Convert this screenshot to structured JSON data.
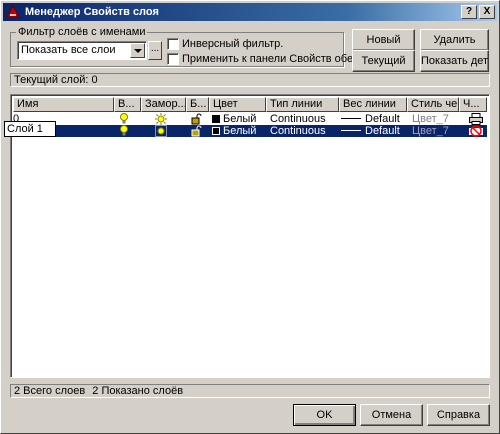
{
  "window": {
    "title": "Менеджер Свойств слоя",
    "help_btn": "?",
    "close_btn": "X"
  },
  "filter": {
    "group_label": "Фильтр слоёв с именами",
    "selected": "Показать все слои",
    "browse_label": "...",
    "invert_label": "Инверсный фильтр.",
    "apply_label": "Применить к панели Свойств обекта."
  },
  "buttons": {
    "new": "Новый",
    "delete": "Удалить",
    "current": "Текущий",
    "details": "Показать детали",
    "ok": "OK",
    "cancel": "Отмена",
    "help": "Справка"
  },
  "current_layer": "Текущий слой:  0",
  "columns": [
    "Имя",
    "В...",
    "Замор...",
    "Б...",
    "Цвет",
    "Тип линии",
    "Вес линии",
    "Стиль че...",
    "Ч..."
  ],
  "layers": [
    {
      "name": "0",
      "color": "Белый",
      "linetype": "Continuous",
      "lineweight": "Default",
      "plotstyle": "Цвет_7",
      "selected": false
    },
    {
      "name": "Слой 1",
      "color": "Белый",
      "linetype": "Continuous",
      "lineweight": "Default",
      "plotstyle": "Цвет_7",
      "selected": true
    }
  ],
  "status": {
    "total": "2 Всего слоев",
    "shown": "2 Показано слоёв"
  },
  "colors": {
    "selection": "#0a246a",
    "face": "#d4d0c8",
    "title_start": "#0a246a"
  }
}
